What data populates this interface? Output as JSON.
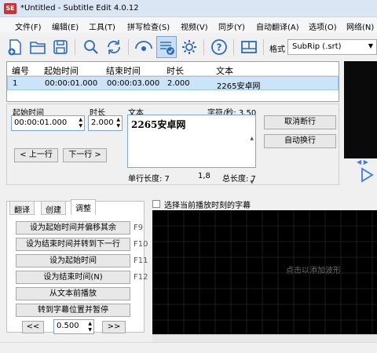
{
  "window": {
    "title": "*Untitled - Subtitle Edit 4.0.12",
    "icon_text": "SE"
  },
  "menu": [
    "文件(F)",
    "编辑(E)",
    "工具(T)",
    "拼写检查(S)",
    "视频(V)",
    "同步(Y)",
    "自动翻译(A)",
    "选项(O)",
    "网络(N)"
  ],
  "toolbar": {
    "icons": [
      "new-file-icon",
      "open-folder-icon",
      "save-icon",
      "find-icon",
      "replace-icon",
      "visual-sync-icon",
      "spell-check-icon",
      "settings-icon",
      "help-icon",
      "layout-icon"
    ],
    "format_label": "格式",
    "format_value": "SubRip (.srt)"
  },
  "grid": {
    "headers": [
      "编号",
      "起始时间",
      "结束时间",
      "时长",
      "文本"
    ],
    "rows": [
      {
        "num": "1",
        "start": "00:00:01.000",
        "end": "00:00:03.000",
        "duration": "2.000",
        "text": "2265安卓网"
      }
    ]
  },
  "editor": {
    "start_label": "起始时间",
    "start_value": "00:00:01.000",
    "duration_label": "时长",
    "duration_value": "2.000",
    "text_label": "文本",
    "chars_per_sec": "字符/秒: 3.50",
    "text_value": "2265安卓网",
    "prev_button": "< 上一行",
    "next_button": "下一行 >",
    "unbreak_button": "取消断行",
    "auto_break_button": "自动换行",
    "line_length": "单行长度: 7",
    "position": "1,8",
    "total_length": "总长度: 7"
  },
  "tabs": [
    "翻译",
    "创建",
    "调整"
  ],
  "adjust": {
    "buttons": [
      {
        "label": "设为起始时间并偏移其余",
        "key": "F9"
      },
      {
        "label": "设为结束时间并转到下一行",
        "key": "F10"
      },
      {
        "label": "设为起始时间",
        "key": "F11"
      },
      {
        "label": "设为结束时间(N)",
        "key": "F12"
      },
      {
        "label": "从文本前播放",
        "key": ""
      },
      {
        "label": "转到字幕位置并暂停",
        "key": ""
      }
    ],
    "rewind": "<<",
    "forward": ">>",
    "step_value": "0.500"
  },
  "waveform": {
    "checkbox_label": "选择当前播放时刻的字幕",
    "hint": "点击以添加波形"
  },
  "colors": {
    "accent": "#3b7de0",
    "selection": "#cce4f7",
    "video_bg": "#0a0a0a"
  }
}
